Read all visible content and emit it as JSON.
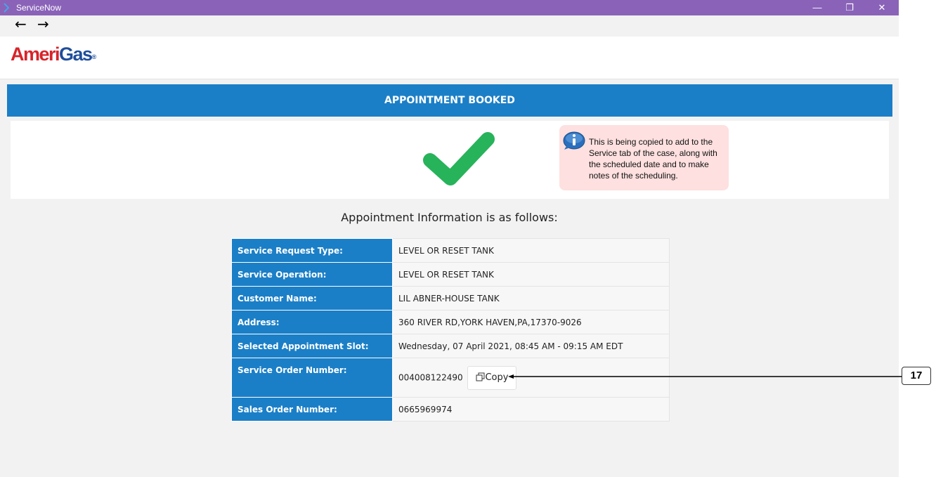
{
  "window": {
    "title": "ServiceNow",
    "minimize_glyph": "—",
    "restore_glyph": "❐",
    "close_glyph": "✕"
  },
  "nav": {
    "back_glyph": "←",
    "forward_glyph": "→"
  },
  "brand": {
    "logo_red_1": "Ameri",
    "logo_blue": "Gas",
    "logo_reg": "®",
    "colors": {
      "red": "#d8232a",
      "blue": "#1f4e9a"
    }
  },
  "banner": {
    "title": "APPOINTMENT BOOKED",
    "color": "#1b7fc7"
  },
  "note": {
    "text": "This is being copied to add to the Service tab of the case, along with the scheduled date and to make notes of the scheduling."
  },
  "appointment": {
    "heading": "Appointment Information is as follows:",
    "rows": [
      {
        "label": "Service Request Type:",
        "value": "LEVEL OR RESET TANK"
      },
      {
        "label": "Service Operation:",
        "value": "LEVEL OR RESET TANK"
      },
      {
        "label": "Customer Name:",
        "value": "LIL ABNER-HOUSE TANK"
      },
      {
        "label": "Address:",
        "value": "360 RIVER RD,YORK HAVEN,PA,17370-9026"
      },
      {
        "label": "Selected Appointment Slot:",
        "value": "Wednesday, 07 April 2021, 08:45 AM - 09:15 AM EDT"
      },
      {
        "label": "Service Order Number:",
        "value": "004008122490",
        "button": "Copy"
      },
      {
        "label": "Sales Order Number:",
        "value": "0665969974"
      }
    ]
  },
  "callout": {
    "number": "17"
  },
  "icons": {
    "success": "check-icon",
    "info": "info-icon",
    "copy": "copy-icon"
  }
}
